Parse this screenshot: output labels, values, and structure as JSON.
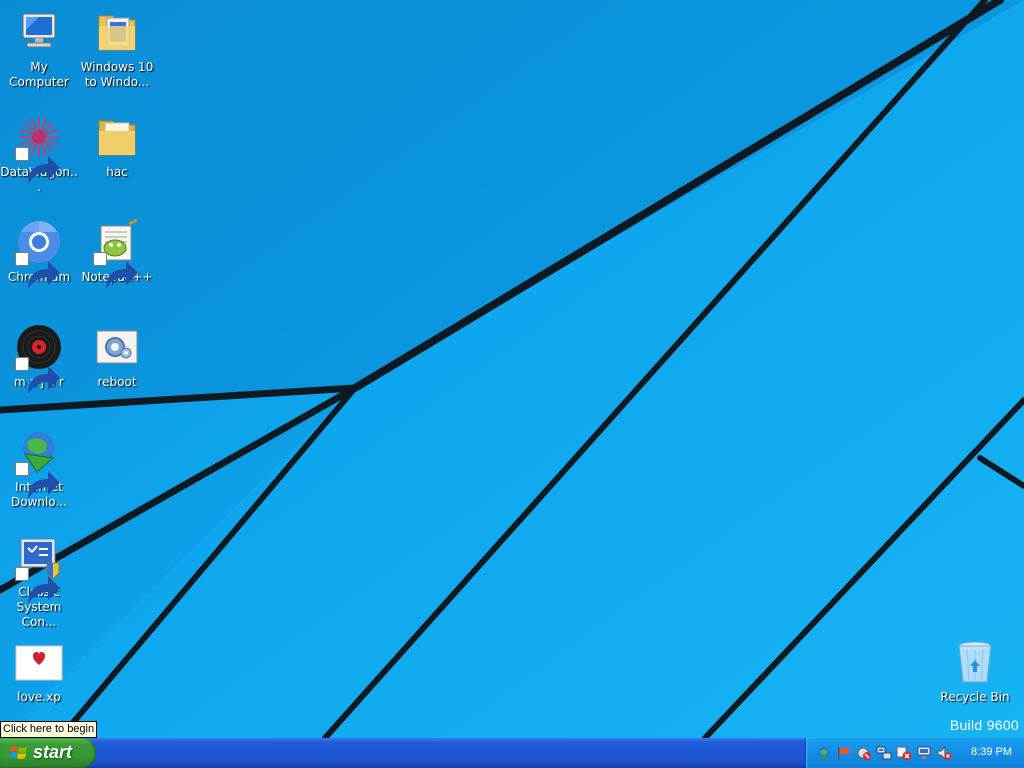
{
  "desktop_icons": [
    {
      "name": "my-computer-icon",
      "label": "My Computer",
      "shortcut": false
    },
    {
      "name": "windows10-folder-icon",
      "label": "Windows 10 to Windo...",
      "shortcut": false
    },
    {
      "name": "datawagon-icon",
      "label": "DataWagon...",
      "shortcut": true
    },
    {
      "name": "hac-folder-icon",
      "label": "hac",
      "shortcut": false
    },
    {
      "name": "chromium-icon",
      "label": "Chromium",
      "shortcut": true
    },
    {
      "name": "notepad-plus-plus-icon",
      "label": "Notepad++",
      "shortcut": true
    },
    {
      "name": "major-icon",
      "label": "m a j o r",
      "shortcut": true
    },
    {
      "name": "reboot-icon",
      "label": "reboot",
      "shortcut": false
    },
    {
      "name": "internet-download-icon",
      "label": "Internet Downlo...",
      "shortcut": true
    },
    {
      "name": "classic-system-control-icon",
      "label": "Classic System Con...",
      "shortcut": true
    },
    {
      "name": "love-xp-icon",
      "label": "love.xp",
      "shortcut": false
    },
    {
      "name": "recycle-bin-icon",
      "label": "Recycle Bin",
      "shortcut": false
    }
  ],
  "build_text": "Build 9600",
  "tooltip": "Click here to begin",
  "taskbar": {
    "start_label": "start",
    "clock": "8:39 PM",
    "tray_icons": [
      "network-globe-icon",
      "flag-icon",
      "bluetooth-icon",
      "network-computers-icon",
      "security-alert-icon",
      "network-connection-icon",
      "volume-muted-icon"
    ]
  },
  "colors": {
    "desktop_background": "#0aa0ec",
    "wallpaper_lines": "#0d1a22",
    "taskbar": "#245edb",
    "start_button": "#3a9d36",
    "tray": "#138fe6"
  }
}
